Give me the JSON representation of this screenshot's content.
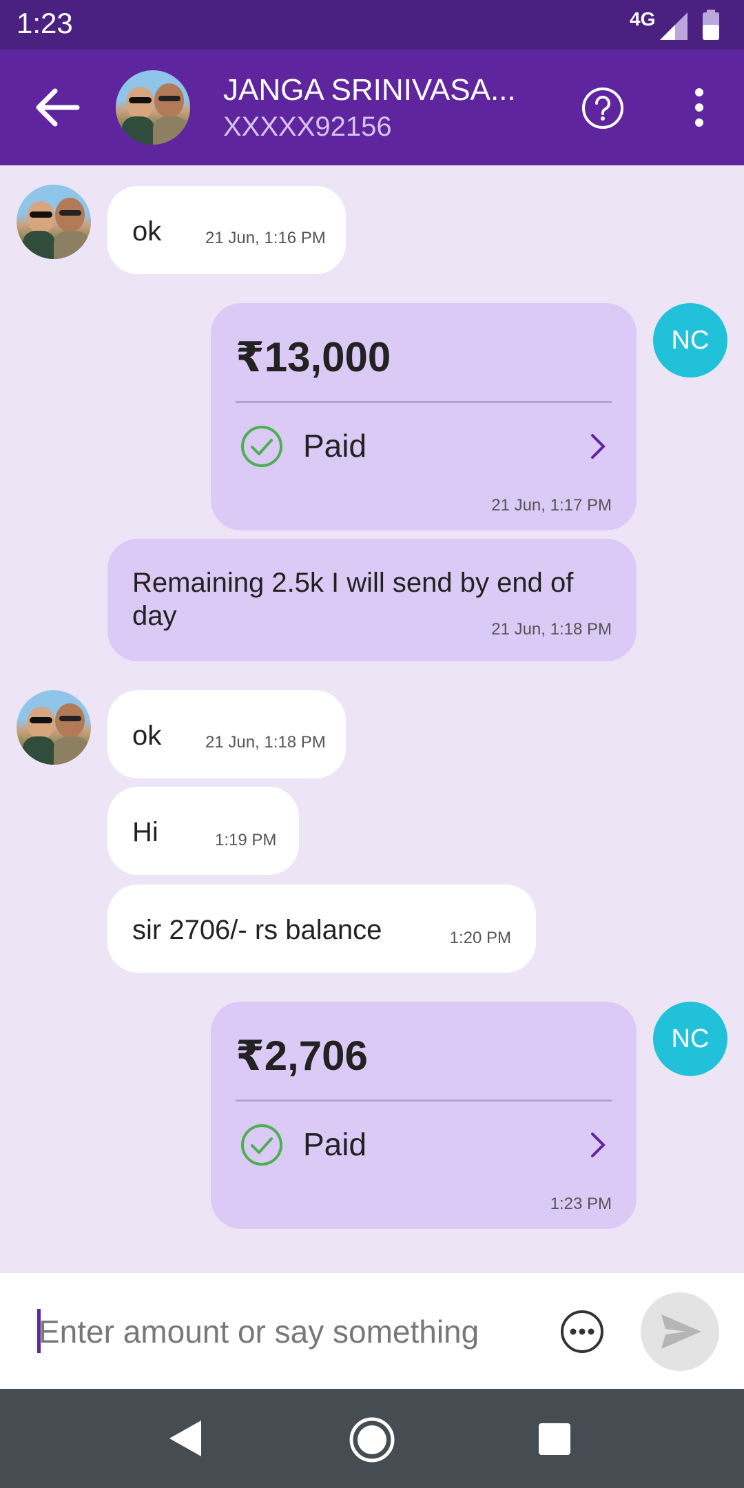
{
  "status_bar": {
    "time": "1:23",
    "network": "4G"
  },
  "header": {
    "contact_name": "JANGA SRINIVASA...",
    "contact_number": "XXXXX92156"
  },
  "messages": [
    {
      "type": "text",
      "direction": "in",
      "text": "ok",
      "time": "21 Jun, 1:16 PM"
    },
    {
      "type": "payment",
      "direction": "out",
      "avatar": "NC",
      "amount": "₹13,000",
      "status": "Paid",
      "time": "21 Jun, 1:17 PM"
    },
    {
      "type": "text",
      "direction": "out",
      "text": "Remaining 2.5k I will send by end of day",
      "time": "21 Jun, 1:18 PM"
    },
    {
      "type": "text",
      "direction": "in",
      "text": "ok",
      "time": "21 Jun, 1:18 PM"
    },
    {
      "type": "text",
      "direction": "in",
      "text": "Hi",
      "time": "1:19 PM"
    },
    {
      "type": "text",
      "direction": "in",
      "text": "sir 2706/- rs balance",
      "time": "1:20 PM"
    },
    {
      "type": "payment",
      "direction": "out",
      "avatar": "NC",
      "amount": "₹2,706",
      "status": "Paid",
      "time": "1:23 PM"
    }
  ],
  "composer": {
    "placeholder": "Enter amount or say something"
  },
  "colors": {
    "primary": "#5f259f",
    "status_bar": "#4a2180",
    "chat_bg": "#ede5f6",
    "outgoing_bubble": "#dccaf6",
    "incoming_bubble": "#ffffff",
    "sender_avatar": "#21c2d9",
    "paid_check": "#4caf50"
  },
  "icons": {
    "back": "arrow-left-icon",
    "help": "help-circle-icon",
    "more": "more-vert-icon",
    "paid": "check-circle-icon",
    "chevron": "chevron-right-icon",
    "options": "more-horiz-icon",
    "send": "send-icon"
  }
}
